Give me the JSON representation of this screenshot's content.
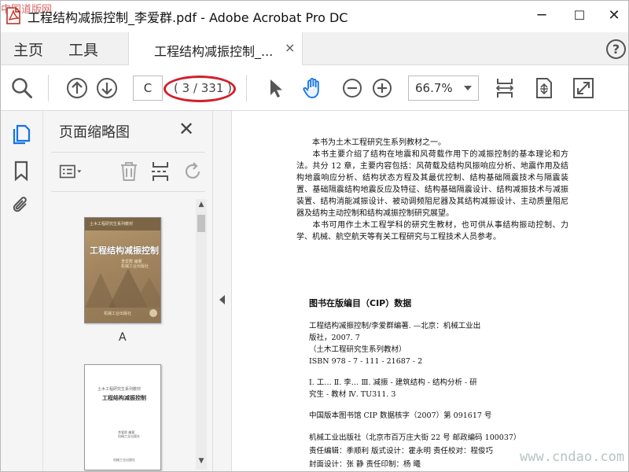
{
  "window": {
    "title": "工程结构减振控制_李爱群.pdf - Adobe Acrobat Pro DC",
    "watermark_top": "中国道版网",
    "controls": {
      "minimize": "─",
      "maximize": "☐",
      "close": "✕"
    }
  },
  "tabbar": {
    "home": "主页",
    "tools": "工具",
    "doc_tab": "工程结构减振控制_...",
    "doc_tab_close": "×",
    "help": "?"
  },
  "toolbar": {
    "current_page": "C",
    "page_total": "( 3 / 331 )",
    "zoom": "66.7%"
  },
  "thumbnails": {
    "title": "页面缩略图",
    "close": "✕",
    "thumb1": {
      "series": "土木工程研究生系列教材",
      "title": "工程结构减振控制",
      "author": "李爱群  编著",
      "author2": "机械工业出版社",
      "publisher": "机械工业出版社",
      "label": "A"
    },
    "thumb2": {
      "series": "土木工程研究生系列教材",
      "title": "工程结构减振控制",
      "author": "李爱群  编著",
      "author2": "机械工业出版社",
      "publisher": "机械工业出版社"
    }
  },
  "document": {
    "intro": [
      "本书为土木工程研究生系列教材之一。",
      "本书主要介绍了结构在地震和风荷载作用下的减振控制的基本理论和方法。共分 12 章，主要内容包括：风荷载及结构风振响应分析、地震作用及结构地震响应分析、结构状态方程及其最优控制、结构基础隔震技术与隔震装置、基础隔震结构地震反应及特征、结构基础隔震设计、结构减振技术与减振装置、结构消能减振设计、被动调频阻尼器及其结构减振设计、主动质量阻尼器及结构主动控制和结构减振控制研究展望。",
      "本书可用作土木工程学科的研究生教材，也可供从事结构振动控制、力学、机械、航空航天等有关工程研究与工程技术人员参考。"
    ],
    "cip_heading": "图书在版编目（CIP）数据",
    "cip_lines": [
      "工程结构减振控制/李爱群编著. —北京：机械工业出",
      "版社，2007. 7",
      "（土木工程研究生系列教材）",
      "ISBN 978 - 7 - 111 - 21687 - 2",
      "",
      "Ⅰ. 工…  Ⅱ. 李…  Ⅲ. 减振 - 建筑结构 - 结构分析 - 研",
      "究生 - 教材  Ⅳ. TU311. 3",
      "",
      "中国版本图书馆 CIP 数据核字（2007）第 091617 号",
      "",
      "机械工业出版社（北京市百万庄大街 22 号  邮政编码 100037）",
      "责任编辑：季顺利  版式设计：霍永明  责任校对：程俊巧",
      "封面设计：张  静  责任印制：杨  曦"
    ],
    "watermark_bottom": "www.cndao.com"
  },
  "colors": {
    "accent_blue": "#1473e6",
    "annotation_red": "#d1202a",
    "icon_gray": "#555555"
  }
}
